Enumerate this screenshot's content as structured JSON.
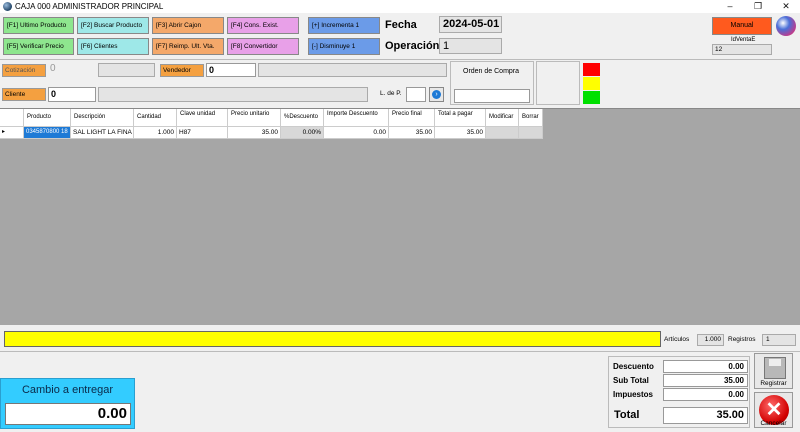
{
  "window": {
    "title": "CAJA 000  ADMINISTRADOR  PRINCIPAL",
    "minimize_glyph": "–",
    "restore_glyph": "❐",
    "close_glyph": "✕"
  },
  "function_keys": {
    "f1": "[F1] Ultimo Producto",
    "f2": "[F2] Buscar Producto",
    "f3": "[F3] Abrir Cajon",
    "f4": "[F4] Cons. Exist.",
    "f5": "[F5] Verificar Precio",
    "f6": "[F6] Clientes",
    "f7": "[F7] Reimp. Ult. Vta.",
    "f8": "[F8] Convertidor",
    "increment": "[+] Incrementa 1",
    "decrement": "[-] Disminuye 1"
  },
  "header": {
    "fecha_label": "Fecha",
    "fecha_value": "2024-05-01",
    "operacion_label": "Operación",
    "operacion_value": "1",
    "manual_label": "Manual",
    "idventa_label": "IdVentaE",
    "idventa_value": "12"
  },
  "sale_info": {
    "cotizacion_label": "Cotización",
    "cotizacion_value": "0",
    "vendedor_label": "Vendedor",
    "vendedor_value": "0",
    "cliente_label": "Cliente",
    "cliente_value": "0",
    "ldep_label": "L. de P.",
    "orden_label": "Orden de Compra"
  },
  "colors": {
    "light_red": "#ff0000",
    "light_yellow": "#ffff00",
    "light_green": "#00e000",
    "progress_yellow": "#ffff00",
    "cambio_blue": "#33ccff",
    "manual_orange": "#ff5a1e"
  },
  "table": {
    "headers": {
      "producto": "Producto",
      "descripcion": "Descripción",
      "cantidad": "Cantidad",
      "clave": "Clave unidad",
      "precio_unitario": "Precio unitario",
      "pct_descuento": "%Descuento",
      "importe_descuento": "Importe Descuento",
      "precio_final": "Precio final",
      "total_pagar": "Total a pagar",
      "modificar": "Modificar",
      "borrar": "Borrar"
    },
    "rows": [
      {
        "producto": "0345870800 18",
        "descripcion": "SAL LIGHT LA FINA",
        "cantidad": "1.000",
        "clave": "H87",
        "precio_unitario": "35.00",
        "pct_descuento": "0.00%",
        "importe_descuento": "0.00",
        "precio_final": "35.00",
        "total_pagar": "35.00"
      }
    ]
  },
  "status": {
    "articulos_label": "Artículos",
    "articulos_value": "1.000",
    "registros_label": "Registros",
    "registros_value": "1"
  },
  "cambio": {
    "label": "Cambio a entregar",
    "value": "0.00"
  },
  "totals": {
    "descuento_label": "Descuento",
    "descuento_value": "0.00",
    "subtotal_label": "Sub Total",
    "subtotal_value": "35.00",
    "impuestos_label": "Impuestos",
    "impuestos_value": "0.00",
    "total_label": "Total",
    "total_value": "35.00"
  },
  "actions": {
    "registrar_label": "Registrar",
    "cancelar_label": "Cancelar"
  }
}
